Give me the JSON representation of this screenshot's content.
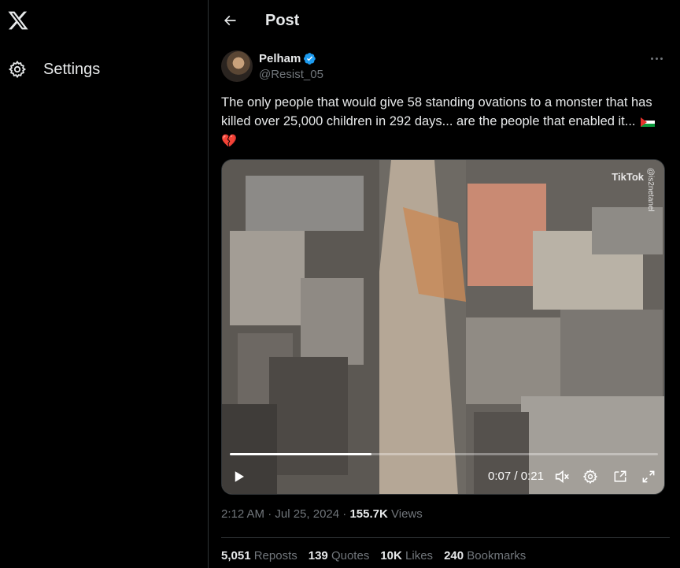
{
  "nav": {
    "settings_label": "Settings"
  },
  "header": {
    "title": "Post"
  },
  "post": {
    "author_name": "Pelham",
    "author_handle": "@Resist_05",
    "text": "The only people that would give 58 standing ovations to a monster that has killed over 25,000 children in 292 days... are the people that enabled it...",
    "video": {
      "current_time": "0:07",
      "duration": "0:21",
      "progress": 0.33,
      "watermark": "TikTok",
      "watermark_handle": "@is2netanel"
    },
    "timestamp": "2:12 AM · Jul 25, 2024",
    "views_count": "155.7K",
    "views_label": "Views",
    "stats": [
      {
        "count": "5,051",
        "label": "Reposts"
      },
      {
        "count": "139",
        "label": "Quotes"
      },
      {
        "count": "10K",
        "label": "Likes"
      },
      {
        "count": "240",
        "label": "Bookmarks"
      }
    ]
  },
  "colors": {
    "background": "#000000",
    "text_primary": "#e7e9ea",
    "text_secondary": "#71767b",
    "verified_blue": "#1d9bf0",
    "divider": "#2f3336"
  },
  "icons": [
    "x-logo-icon",
    "gear-icon",
    "back-arrow-icon",
    "verified-badge-icon",
    "more-icon",
    "play-icon",
    "mute-icon",
    "gear-icon",
    "pip-icon",
    "fullscreen-icon"
  ]
}
